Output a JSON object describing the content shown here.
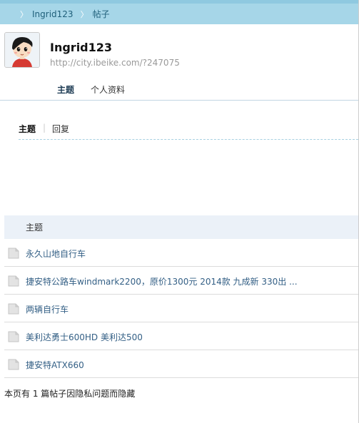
{
  "breadcrumb": {
    "items": [
      {
        "label": "Ingrid123"
      },
      {
        "label": "帖子"
      }
    ]
  },
  "profile": {
    "username": "Ingrid123",
    "url": "http://city.ibeike.com/?247075"
  },
  "profile_tabs": [
    {
      "label": "主题",
      "active": true
    },
    {
      "label": "个人资料",
      "active": false
    }
  ],
  "sub_tabs": [
    {
      "label": "主题",
      "active": true
    },
    {
      "label": "回复",
      "active": false
    }
  ],
  "table": {
    "header": "主题",
    "rows": [
      {
        "title": "永久山地自行车"
      },
      {
        "title": "捷安特公路车windmark2200，原价1300元 2014款 九成新 330出 ..."
      },
      {
        "title": "两辆自行车"
      },
      {
        "title": "美利达勇士600HD 美利达500"
      },
      {
        "title": "捷安特ATX660"
      }
    ]
  },
  "footer_note": "本页有 1 篇帖子因隐私问题而隐藏",
  "colors": {
    "breadcrumb_bg": "#a6d6e8",
    "header_row_bg": "#ebf1f8",
    "link_text": "#335f85"
  }
}
